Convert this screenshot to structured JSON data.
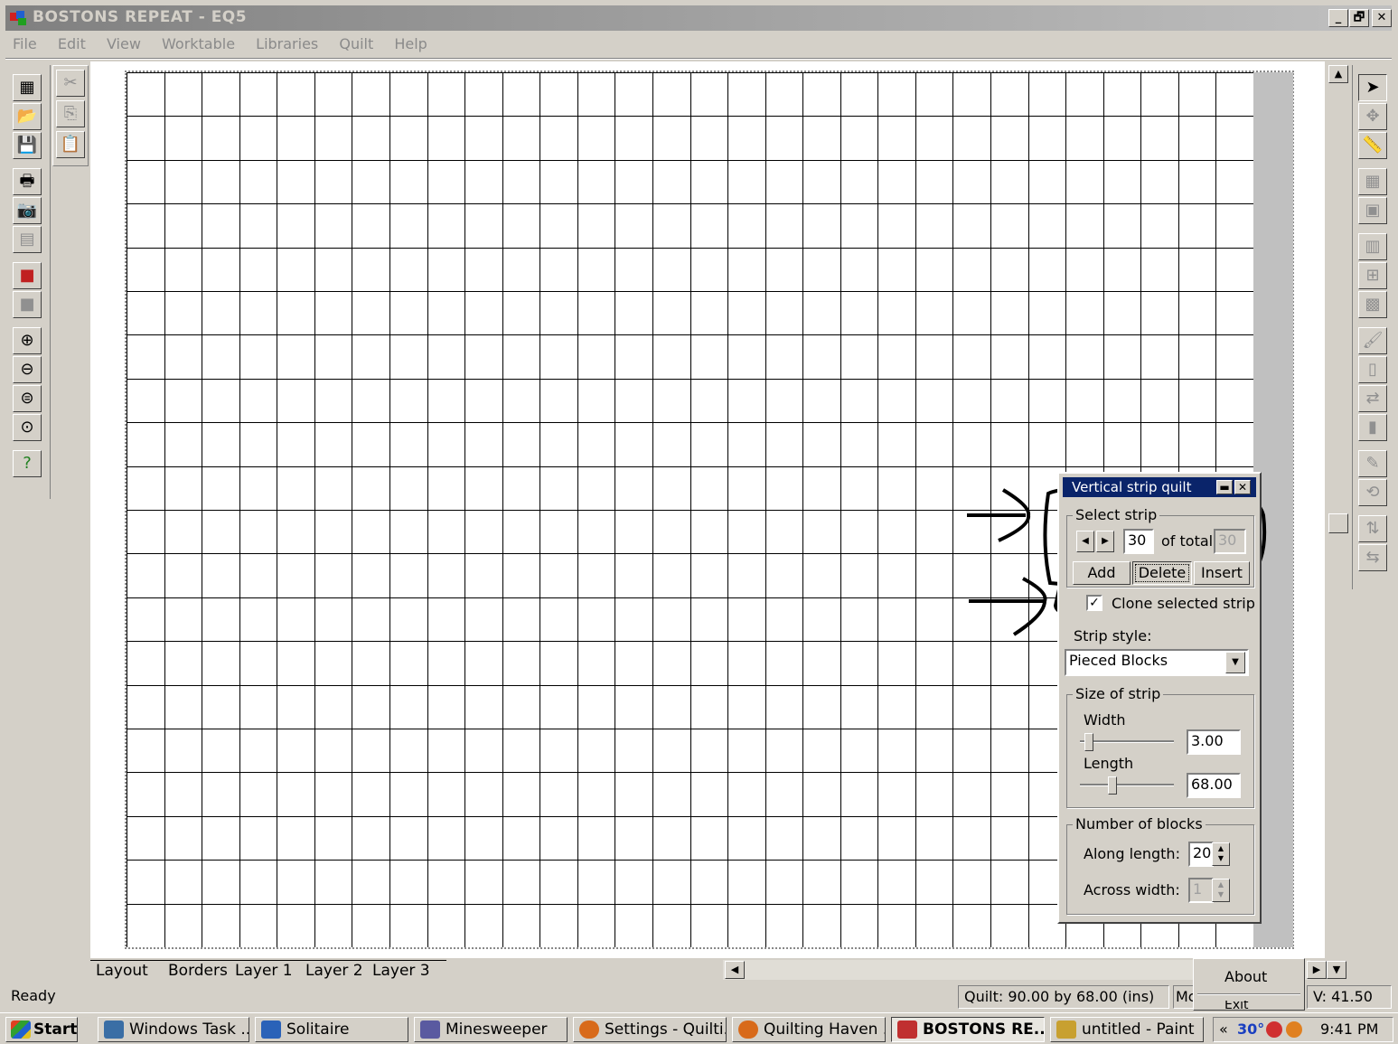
{
  "window": {
    "title": "BOSTONS REPEAT - EQ5",
    "minimize": "_",
    "maximize": "🗗",
    "close": "✕"
  },
  "menu": [
    "File",
    "Edit",
    "View",
    "Worktable",
    "Libraries",
    "Quilt",
    "Help"
  ],
  "left_toolbar": {
    "tools": [
      "new-quilt-icon",
      "open-icon",
      "save-icon",
      "print-icon",
      "camera-icon",
      "gray-block-icon",
      "fabric-icon",
      "swatch-icon",
      "zoom-in-icon",
      "zoom-out-icon",
      "zoom-fit-icon",
      "zoom-page-icon",
      "help-icon"
    ],
    "edit_tools": [
      "cut-icon",
      "copy-icon",
      "paste-icon"
    ]
  },
  "right_toolbar": [
    "pointer-icon",
    "adjust-tool-icon",
    "ruler-icon",
    "layout-tool-icon",
    "borders-tool-icon",
    "block-tool-icon",
    "set-block-icon",
    "symmetry-icon",
    "paintbrush-icon",
    "spraycan-icon",
    "swap-icon",
    "bucket-icon",
    "eyedropper-icon",
    "rotate-icon",
    "flip-icon",
    "random-icon"
  ],
  "tabs": [
    "Layout",
    "Borders",
    "Layer 1",
    "Layer 2",
    "Layer 3"
  ],
  "status": {
    "ready": "Ready",
    "quilt": "Quilt:   90.00 by 68.00 (ins)",
    "mode": "Mc",
    "vertical": "V:  41.50"
  },
  "popup_menu": {
    "item": "About",
    "item2": "Exit"
  },
  "dialog": {
    "title": "Vertical strip quilt",
    "select_strip": "Select strip",
    "strip_value": "30",
    "of_total": "of total:",
    "total_value": "30",
    "add": "Add",
    "delete": "Delete",
    "insert": "Insert",
    "clone_checked": true,
    "clone_label": "Clone selected strip",
    "strip_style_label": "Strip style:",
    "strip_style_value": "Pieced Blocks",
    "size_of_strip": "Size of strip",
    "width_label": "Width",
    "width_value": "3.00",
    "width_slider": 0.1,
    "length_label": "Length",
    "length_value": "68.00",
    "length_slider": 0.35,
    "number_of_blocks": "Number of blocks",
    "along_label": "Along length:",
    "along_value": "20",
    "across_label": "Across width:",
    "across_value": "1"
  },
  "taskbar": {
    "start": "Start",
    "tasks": [
      {
        "label": "Windows Task ...",
        "color": "#3a6ea5"
      },
      {
        "label": "Solitaire",
        "color": "#2a62b8"
      },
      {
        "label": "Minesweeper",
        "color": "#5a5aa0"
      },
      {
        "label": "Settings - Quilti...",
        "color": "#d86a1a"
      },
      {
        "label": "Quilting Haven ...",
        "color": "#d86a1a"
      },
      {
        "label": "BOSTONS RE...",
        "color": "#c03030"
      },
      {
        "label": "untitled - Paint",
        "color": "#c8a030"
      }
    ],
    "tray_temp": "30°",
    "clock": "9:41 PM"
  },
  "colors": {
    "title_gradient_start": "#808080",
    "dialog_title": "#0a246a",
    "grid_line": "#000000"
  }
}
